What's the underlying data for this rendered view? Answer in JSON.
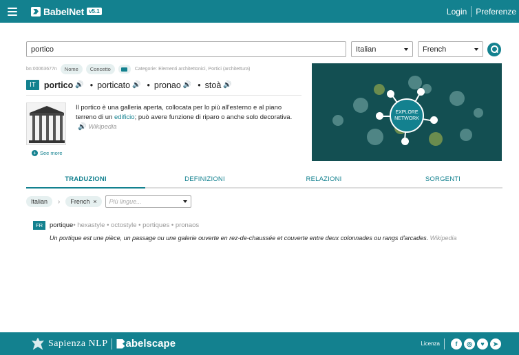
{
  "header": {
    "app_name": "BabelNet",
    "version": "v5.1",
    "login": "Login",
    "preferences": "Preferenze"
  },
  "search": {
    "query": "portico",
    "source_lang": "Italian",
    "target_lang": "French"
  },
  "synset": {
    "id": "bn:00063677n",
    "pos_chip": "Nome",
    "type_chip": "Concetto",
    "categories": "Categorie: Elementi architettonici, Portici (architettura)",
    "lang": "IT",
    "lemmas": [
      "portico",
      "porticato",
      "pronao",
      "stoà"
    ],
    "gloss_before": "Il portico è una galleria aperta, collocata per lo più all'esterno e al piano terreno di un ",
    "gloss_link": "edificio",
    "gloss_after": "; può avere funzione di riparo o anche solo decorativa.",
    "gloss_source": "Wikipedia",
    "see_more": "See more"
  },
  "network": {
    "line1": "EXPLORE",
    "line2": "NETWORK"
  },
  "tabs": [
    "TRADUZIONI",
    "DEFINIZIONI",
    "RELAZIONI",
    "SORGENTI"
  ],
  "filters": {
    "source": "Italian",
    "target": "French",
    "more_placeholder": "Più lingue..."
  },
  "translation": {
    "lang": "FR",
    "main": "portique",
    "synonyms": " • hexastyle • octostyle • portiques • pronaos",
    "gloss": "Un portique est une pièce, un passage ou une galerie ouverte en rez-de-chaussée et couverte entre deux colonnades ou rangs d'arcades.",
    "gloss_source": "Wikipedia"
  },
  "footer": {
    "sapienza": "Sapienza NLP",
    "babelscape": "abelscape",
    "license": "Licenza",
    "social_icons": [
      "facebook-icon",
      "instagram-icon",
      "twitter-icon",
      "telegram-icon"
    ]
  },
  "colors": {
    "brand": "#13818f",
    "network_bg": "#134f52"
  }
}
